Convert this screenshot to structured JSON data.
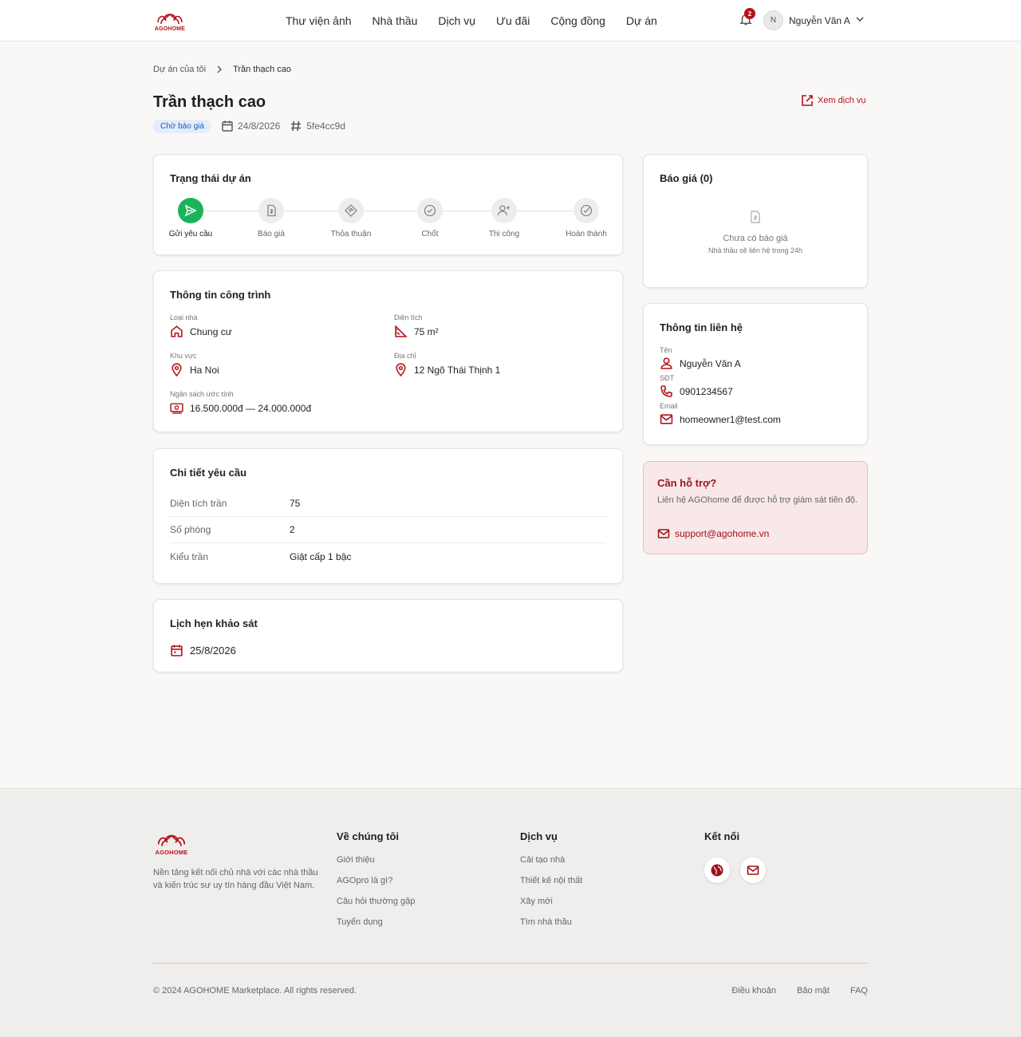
{
  "brand": {
    "name": "AGOHOME",
    "color": "#b5121b"
  },
  "nav": {
    "items": [
      "Thư viện ảnh",
      "Nhà thầu",
      "Dịch vụ",
      "Ưu đãi",
      "Cộng đồng",
      "Dự án"
    ]
  },
  "header": {
    "notification_count": "2",
    "avatar_initial": "N",
    "user_name": "Nguyễn Văn A"
  },
  "breadcrumb": {
    "parent": "Dự án của tôi",
    "current": "Trần thạch cao"
  },
  "project": {
    "title": "Trần thạch cao",
    "status": "Chờ báo giá",
    "date": "24/8/2026",
    "id": "5fe4cc9d",
    "view_service": "Xem dịch vụ"
  },
  "status_card": {
    "title": "Trạng thái dự án",
    "steps": [
      "Gửi yêu cầu",
      "Báo giá",
      "Thỏa thuận",
      "Chốt",
      "Thi công",
      "Hoàn thành"
    ],
    "active_step": 0
  },
  "info_card": {
    "title": "Thông tin công trình",
    "house_type_label": "Loại nhà",
    "house_type": "Chung cư",
    "area_label": "Diện tích",
    "area": "75 m²",
    "region_label": "Khu vực",
    "region": "Ha Noi",
    "address_label": "Địa chỉ",
    "address": "12 Ngõ Thái Thịnh 1",
    "budget_label": "Ngân sách ước tính",
    "budget": "16.500.000đ — 24.000.000đ"
  },
  "detail_card": {
    "title": "Chi tiết yêu cầu",
    "rows": [
      {
        "key": "Diện tích trần",
        "value": "75"
      },
      {
        "key": "Số phòng",
        "value": "2"
      },
      {
        "key": "Kiểu trần",
        "value": "Giật cấp 1 bậc"
      }
    ]
  },
  "survey_card": {
    "title": "Lịch hẹn khảo sát",
    "date": "25/8/2026"
  },
  "quote_card": {
    "title": "Báo giá (0)",
    "empty_title": "Chưa có báo giá",
    "empty_sub": "Nhà thầu sẽ liên hệ trong 24h"
  },
  "contact_card": {
    "title": "Thông tin liên hệ",
    "name_label": "Tên",
    "name": "Nguyễn Văn A",
    "phone_label": "SĐT",
    "phone": "0901234567",
    "email_label": "Email",
    "email": "homeowner1@test.com"
  },
  "support": {
    "title": "Cần hỗ trợ?",
    "desc": "Liên hệ AGOhome để được hỗ trợ giám sát tiến độ.",
    "email": "support@agohome.vn"
  },
  "footer": {
    "desc": "Nền tảng kết nối chủ nhà với các nhà thầu và kiến trúc sư uy tín hàng đầu Việt Nam.",
    "about": {
      "title": "Về chúng tôi",
      "links": [
        "Giới thiệu",
        "AGOpro là gì?",
        "Câu hỏi thường gặp",
        "Tuyển dụng"
      ]
    },
    "services": {
      "title": "Dịch vụ",
      "links": [
        "Cải tạo nhà",
        "Thiết kế nội thất",
        "Xây mới",
        "Tìm nhà thầu"
      ]
    },
    "connect": {
      "title": "Kết nối",
      "icons": [
        "globe-icon",
        "mail-icon"
      ]
    },
    "copyright": "© 2024 AGOHOME Marketplace. All rights reserved.",
    "legal": [
      "Điều khoản",
      "Bảo mật",
      "FAQ"
    ]
  }
}
